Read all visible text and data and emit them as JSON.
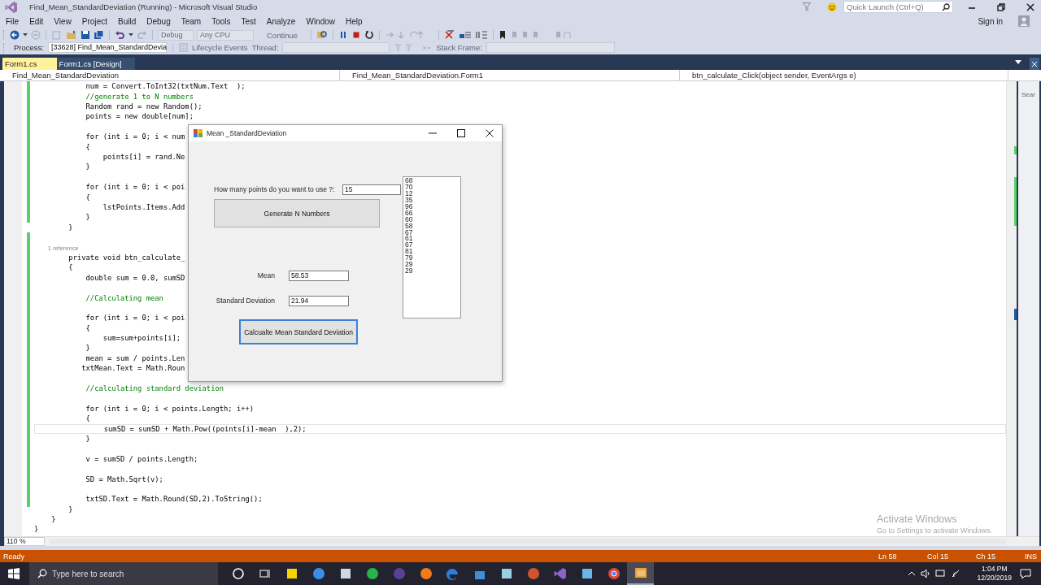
{
  "window": {
    "title": "Find_Mean_StandardDeviation (Running) - Microsoft Visual Studio"
  },
  "quick_launch": {
    "placeholder": "Quick Launch (Ctrl+Q)"
  },
  "menu": [
    "File",
    "Edit",
    "View",
    "Project",
    "Build",
    "Debug",
    "Team",
    "Tools",
    "Test",
    "Analyze",
    "Window",
    "Help"
  ],
  "sign_in": "Sign in",
  "toolbar": {
    "configuration": {
      "label": "Debug",
      "disabled": true
    },
    "platform": {
      "label": "Any CPU",
      "disabled": true
    },
    "continue": "Continue"
  },
  "debug_location": {
    "process_label": "Process:",
    "process": "[33628] Find_Mean_StandardDevia",
    "lifecycle": "Lifecycle Events",
    "thread_label": "Thread:",
    "stack_frame_label": "Stack Frame:"
  },
  "tabs": [
    {
      "label": "Form1.cs",
      "selected": true
    },
    {
      "label": "Form1.cs [Design]",
      "selected": false
    }
  ],
  "navigation": [
    "Find_Mean_StandardDeviation",
    "Find_Mean_StandardDeviation.Form1",
    "btn_calculate_Click(object sender, EventArgs e)"
  ],
  "side_panel": "Sear",
  "code_lines": [
    {
      "text": "            num = Convert.ToInt32(txtNum.Text  );",
      "kind": "code",
      "current": false
    },
    {
      "text": "            //generate 1 to N numbers",
      "kind": "comment",
      "current": false
    },
    {
      "text": "            Random rand = new Random();",
      "kind": "code",
      "current": false
    },
    {
      "text": "            points = new double[num];",
      "kind": "code",
      "current": false
    },
    {
      "kind": "blank",
      "current": false
    },
    {
      "text": "            for (int i = 0; i < num",
      "kind": "code",
      "current": false
    },
    {
      "text": "            {",
      "kind": "code",
      "current": false
    },
    {
      "text": "                points[i] = rand.Ne",
      "kind": "code",
      "current": false
    },
    {
      "text": "            }",
      "kind": "code",
      "current": false
    },
    {
      "kind": "blank",
      "current": false
    },
    {
      "text": "            for (int i = 0; i < poi",
      "kind": "code",
      "current": false
    },
    {
      "text": "            {",
      "kind": "code",
      "current": false
    },
    {
      "text": "                lstPoints.Items.Add",
      "kind": "code",
      "current": false
    },
    {
      "text": "            }",
      "kind": "code",
      "current": false
    },
    {
      "text": "        }",
      "kind": "code",
      "current": false
    },
    {
      "kind": "blank",
      "current": false
    },
    {
      "text": "        1 reference",
      "kind": "codelens",
      "current": false
    },
    {
      "text": "        private void btn_calculate_",
      "kind": "code",
      "current": false
    },
    {
      "text": "        {",
      "kind": "code",
      "current": false
    },
    {
      "text": "            double sum = 0.0, sumSD",
      "kind": "code",
      "current": false
    },
    {
      "kind": "blank",
      "current": false
    },
    {
      "text": "            //Calculating mean",
      "kind": "comment",
      "current": false
    },
    {
      "kind": "blank",
      "current": false
    },
    {
      "text": "            for (int i = 0; i < poi",
      "kind": "code",
      "current": false
    },
    {
      "text": "            {",
      "kind": "code",
      "current": false
    },
    {
      "text": "                sum=sum+points[i];",
      "kind": "code",
      "current": false
    },
    {
      "text": "            }",
      "kind": "code",
      "current": false
    },
    {
      "text": "            mean = sum / points.Len",
      "kind": "code",
      "current": false
    },
    {
      "text": "           txtMean.Text = Math.Roun",
      "kind": "code",
      "current": false
    },
    {
      "kind": "blank",
      "current": false
    },
    {
      "text": "            //calculating standard deviation",
      "kind": "comment",
      "current": false
    },
    {
      "kind": "blank",
      "current": false
    },
    {
      "text": "            for (int i = 0; i < points.Length; i++)",
      "kind": "code",
      "current": false
    },
    {
      "text": "            {",
      "kind": "code",
      "current": false
    },
    {
      "text": "                sumSD = sumSD + Math.Pow((points[i]-mean  ),2);",
      "kind": "code",
      "current": true
    },
    {
      "text": "            }",
      "kind": "code",
      "current": false
    },
    {
      "kind": "blank",
      "current": false
    },
    {
      "text": "            v = sumSD / points.Length;",
      "kind": "code",
      "current": false
    },
    {
      "kind": "blank",
      "current": false
    },
    {
      "text": "            SD = Math.Sqrt(v);",
      "kind": "code",
      "current": false
    },
    {
      "kind": "blank",
      "current": false
    },
    {
      "text": "            txtSD.Text = Math.Round(SD,2).ToString();",
      "kind": "code",
      "current": false
    },
    {
      "text": "        }",
      "kind": "code",
      "current": false
    },
    {
      "text": "    }",
      "kind": "code",
      "current": false
    },
    {
      "text": "}",
      "kind": "code",
      "current": false
    }
  ],
  "zoom": "110 %",
  "dialog": {
    "title": "Mean _StandardDeviation",
    "points_label": "How many points do you want to use ?:",
    "points_value": "15",
    "generate_button": "Generate N Numbers",
    "mean_label": "Mean",
    "mean_value": "58.53",
    "sd_label": "Standard Deviation",
    "sd_value": "21.94",
    "calculate_button": "Calcualte Mean  Standard Deviation",
    "list_items": [
      "68",
      "70",
      "12",
      "35",
      "96",
      "66",
      "60",
      "58",
      "67",
      "61",
      "67",
      "81",
      "79",
      "29",
      "29"
    ]
  },
  "activation_notice": {
    "title": "Activate Windows",
    "text": "Go to Settings to activate Windows."
  },
  "status_bar": {
    "state": "Ready",
    "line": "Ln 58",
    "column": "Col 15",
    "char": "Ch 15",
    "mode": "INS"
  },
  "taskbar": {
    "search_placeholder": "Type here to search",
    "time": "1:04 PM",
    "date": "12/20/2019"
  }
}
